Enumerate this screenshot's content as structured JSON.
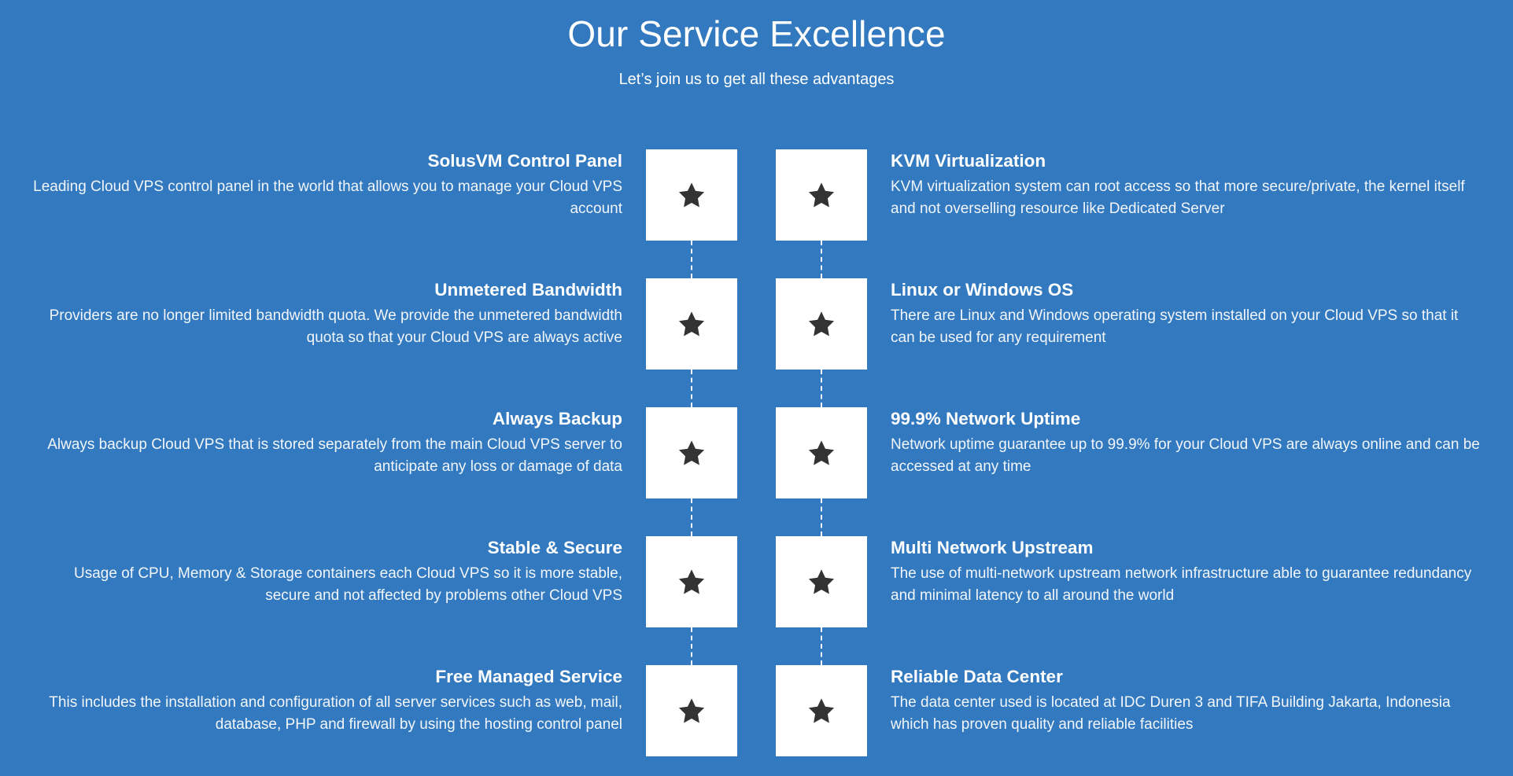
{
  "header": {
    "title": "Our Service Excellence",
    "subtitle": "Let’s join us to get all these advantages"
  },
  "colors": {
    "background": "#3279bf",
    "icon_tile": "#ffffff",
    "icon_glyph": "#333333",
    "text": "#ffffff",
    "connector": "#ffffff"
  },
  "icon": {
    "name": "star-icon",
    "glyph": "★"
  },
  "rows": [
    {
      "left": {
        "title": "SolusVM Control Panel",
        "desc": "Leading Cloud VPS control panel in the world that allows you to manage your Cloud VPS account"
      },
      "right": {
        "title": "KVM Virtualization",
        "desc": "KVM virtualization system can root access so that more secure/private, the kernel itself and not overselling resource like Dedicated Server"
      }
    },
    {
      "left": {
        "title": "Unmetered Bandwidth",
        "desc": "Providers are no longer limited bandwidth quota. We provide the unmetered bandwidth quota so that your Cloud VPS are always active"
      },
      "right": {
        "title": "Linux or Windows OS",
        "desc": "There are Linux and Windows operating system installed on your Cloud VPS so that it can be used for any requirement"
      }
    },
    {
      "left": {
        "title": "Always Backup",
        "desc": "Always backup Cloud VPS that is stored separately from the main Cloud VPS server to anticipate any loss or damage of data"
      },
      "right": {
        "title": "99.9% Network Uptime",
        "desc": "Network uptime guarantee up to 99.9% for your Cloud VPS are always online and can be accessed at any time"
      }
    },
    {
      "left": {
        "title": "Stable & Secure",
        "desc": "Usage of CPU, Memory & Storage containers each Cloud VPS so it is more stable, secure and not affected by problems other Cloud VPS"
      },
      "right": {
        "title": "Multi Network Upstream",
        "desc": "The use of multi-network upstream network infrastructure able to guarantee redundancy and minimal latency to all around the world"
      }
    },
    {
      "left": {
        "title": "Free Managed Service",
        "desc": "This includes the installation and configuration of all server services such as web, mail, database, PHP and firewall by using the hosting control panel"
      },
      "right": {
        "title": "Reliable Data Center",
        "desc": "The data center used is located at IDC Duren 3 and TIFA Building Jakarta, Indonesia which has proven quality and reliable facilities"
      }
    }
  ]
}
